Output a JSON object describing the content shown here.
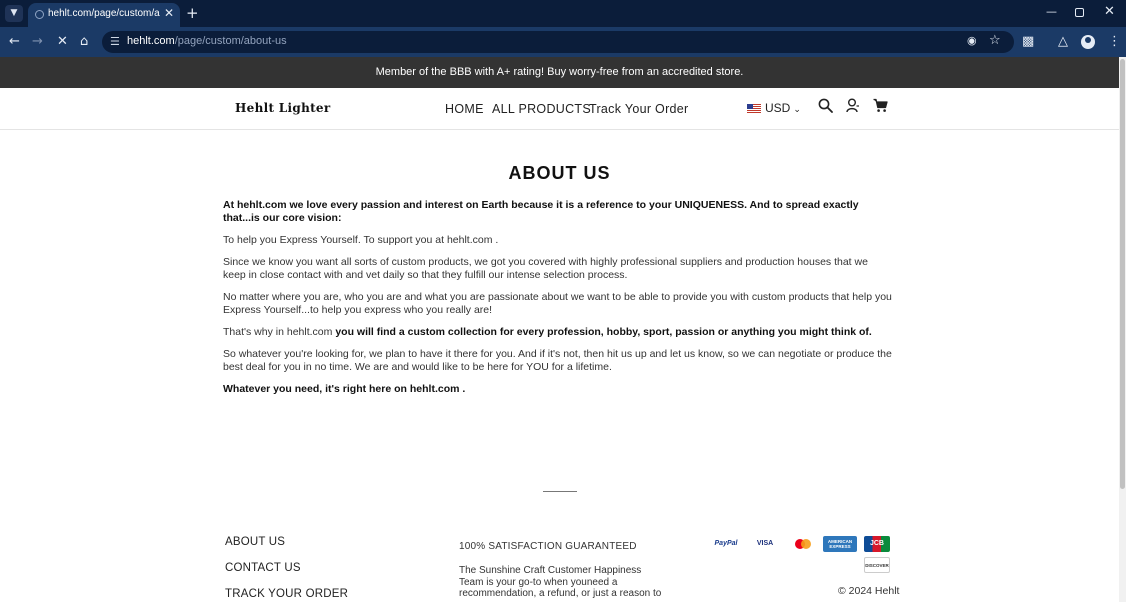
{
  "browser": {
    "tab_title": "hehlt.com/page/custom/about-us",
    "new_tab": "+",
    "url_host": "hehlt.com",
    "url_path": "/page/custom/about-us"
  },
  "promo": "Member of the BBB with A+ rating! Buy worry-free from an accredited store.",
  "header": {
    "logo": "Hehlt Lighter",
    "nav": [
      "HOME",
      "ALL PRODUCTS",
      "Track Your Order"
    ],
    "currency": "USD"
  },
  "page": {
    "title": "ABOUT US",
    "paragraphs": [
      "At hehlt.com  we love every passion and interest on Earth because it is a reference to your UNIQUENESS. And to spread exactly that...is our core vision:",
      "To help you Express Yourself. To support you at hehlt.com .",
      "Since we know you want all sorts of custom products, we got you covered with highly professional suppliers and production houses that we keep in close contact with and vet daily so that they fulfill our intense selection process.",
      "No matter where you are, who you are and what you are passionate about we want to be able to provide you with custom products that help you Express Yourself...to help you express who you really are!",
      "That's why in hehlt.com  you will find a custom collection for every profession, hobby, sport, passion or anything you might think of.",
      "So whatever you're looking for, we plan to have it there for you. And if it's not, then hit us up and let us know, so we can negotiate or produce the best deal for you in no time. We are and would like to be here for YOU for a lifetime.",
      "Whatever you need, it's right here on hehlt.com ."
    ],
    "bold_lead": "That's why in hehlt.com ",
    "bold_rest": " you will find a custom collection for every profession, hobby, sport, passion or anything you might think of."
  },
  "footer": {
    "links": [
      "ABOUT US",
      "CONTACT US",
      "TRACK YOUR ORDER"
    ],
    "guarantee_title": "100% SATISFACTION GUARANTEED",
    "guarantee_text": "The Sunshine Craft Customer Happiness Team is your go-to when youneed a recommendation, a refund, or just a reason to",
    "payments": [
      "PayPal",
      "VISA",
      "mastercard",
      "AMERICAN EXPRESS",
      "JCB",
      "DISCOVER"
    ],
    "copyright": "© 2024 Hehlt"
  }
}
